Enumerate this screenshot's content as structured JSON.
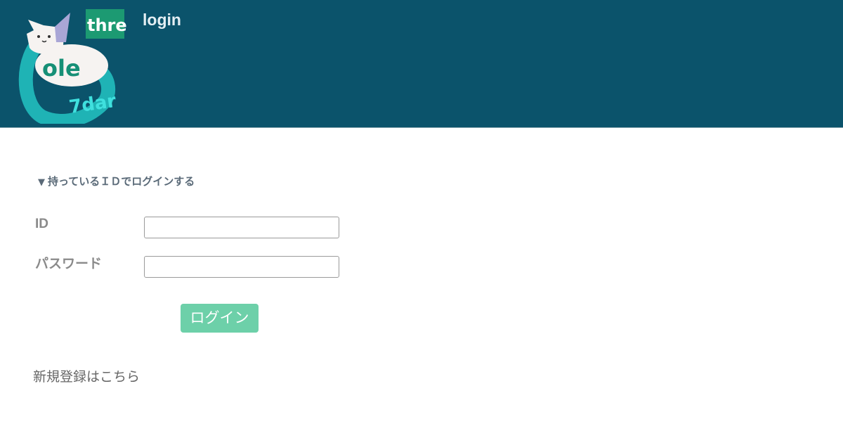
{
  "header": {
    "title": "login",
    "logo": {
      "icon": "cat-logo-icon",
      "text_top": "three",
      "text_middle": "ole",
      "text_bottom": "7dar"
    },
    "background_color": "#0b536b"
  },
  "login_section": {
    "heading_marker": "▼",
    "heading": "持っているＩＤでログインする",
    "id_label": "ID",
    "id_value": "",
    "password_label": "パスワード",
    "password_value": "",
    "submit_label": "ログイン",
    "submit_color": "#6dd0a9"
  },
  "register_link": "新規登録はこちら"
}
